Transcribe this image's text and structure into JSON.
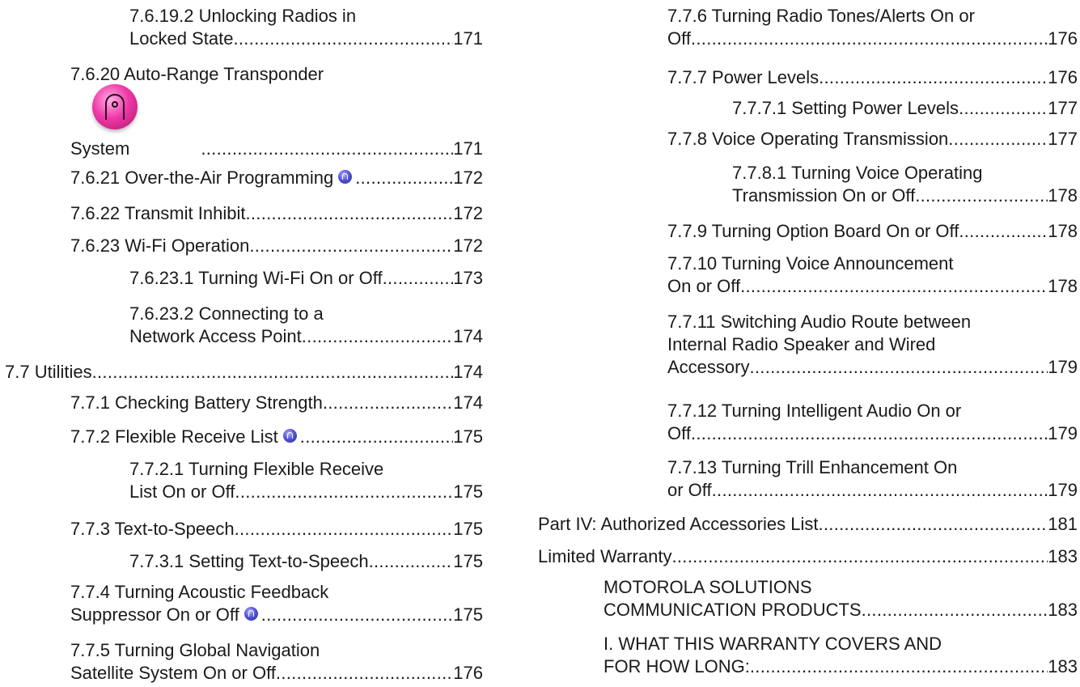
{
  "left_column": [
    {
      "lines": [
        "7.6.19.2 Unlocking Radios in"
      ],
      "last": "Locked State",
      "page": "171"
    },
    {
      "lines": [
        "7.6.20 Auto-Range Transponder"
      ],
      "last": "System",
      "page": "171",
      "icon": "motorola-pink-feature-icon"
    },
    {
      "last": "7.6.21 Over-the-Air Programming",
      "page": "172",
      "icon": "motorola-blue-feature-icon"
    },
    {
      "last": "7.6.22 Transmit Inhibit",
      "page": "172"
    },
    {
      "last": "7.6.23 Wi-Fi Operation",
      "page": "172"
    },
    {
      "last": "7.6.23.1 Turning Wi-Fi On or Off",
      "page": "173"
    },
    {
      "lines": [
        "7.6.23.2 Connecting to a"
      ],
      "last": "Network Access Point",
      "page": "174"
    },
    {
      "last": "7.7 Utilities",
      "page": "174"
    },
    {
      "last": "7.7.1 Checking Battery Strength",
      "page": "174"
    },
    {
      "last": "7.7.2 Flexible Receive List",
      "page": "175",
      "icon": "motorola-blue-feature-icon"
    },
    {
      "lines": [
        "7.7.2.1 Turning Flexible Receive"
      ],
      "last": "List On or Off",
      "page": "175"
    },
    {
      "last": "7.7.3 Text-to-Speech",
      "page": "175"
    },
    {
      "last": "7.7.3.1 Setting Text-to-Speech",
      "page": "175"
    },
    {
      "lines": [
        "7.7.4 Turning Acoustic Feedback"
      ],
      "last": "Suppressor On or Off",
      "page": "175",
      "icon": "motorola-blue-feature-icon"
    },
    {
      "lines": [
        "7.7.5 Turning Global Navigation"
      ],
      "last": "Satellite System On or Off",
      "page": "176"
    }
  ],
  "right_column": [
    {
      "lines": [
        "7.7.6 Turning Radio Tones/Alerts On or"
      ],
      "last": "Off",
      "page": "176"
    },
    {
      "last": "7.7.7 Power Levels",
      "page": "176"
    },
    {
      "last": "7.7.7.1 Setting Power Levels",
      "page": "177"
    },
    {
      "last": "7.7.8 Voice Operating Transmission",
      "page": "177"
    },
    {
      "lines": [
        "7.7.8.1 Turning Voice Operating"
      ],
      "last": "Transmission On or Off",
      "page": "178"
    },
    {
      "last": "7.7.9 Turning Option Board On or Off",
      "page": "178"
    },
    {
      "lines": [
        "7.7.10 Turning Voice Announcement"
      ],
      "last": "On or Off",
      "page": "178"
    },
    {
      "lines": [
        "7.7.11 Switching Audio Route between",
        "Internal Radio Speaker and Wired"
      ],
      "last": "Accessory",
      "page": "179"
    },
    {
      "lines": [
        "7.7.12 Turning Intelligent Audio On or"
      ],
      "last": "Off",
      "page": "179"
    },
    {
      "lines": [
        "7.7.13 Turning Trill Enhancement On"
      ],
      "last": "or Off",
      "page": "179"
    },
    {
      "last": "Part  IV:  Authorized Accessories List",
      "page": "181"
    },
    {
      "last": "Limited Warranty",
      "page": "183"
    },
    {
      "lines": [
        "MOTOROLA SOLUTIONS"
      ],
      "last": "COMMUNICATION PRODUCTS",
      "page": "183"
    },
    {
      "lines": [
        "I. WHAT THIS WARRANTY COVERS AND"
      ],
      "last": "FOR HOW LONG:",
      "page": "183"
    }
  ]
}
